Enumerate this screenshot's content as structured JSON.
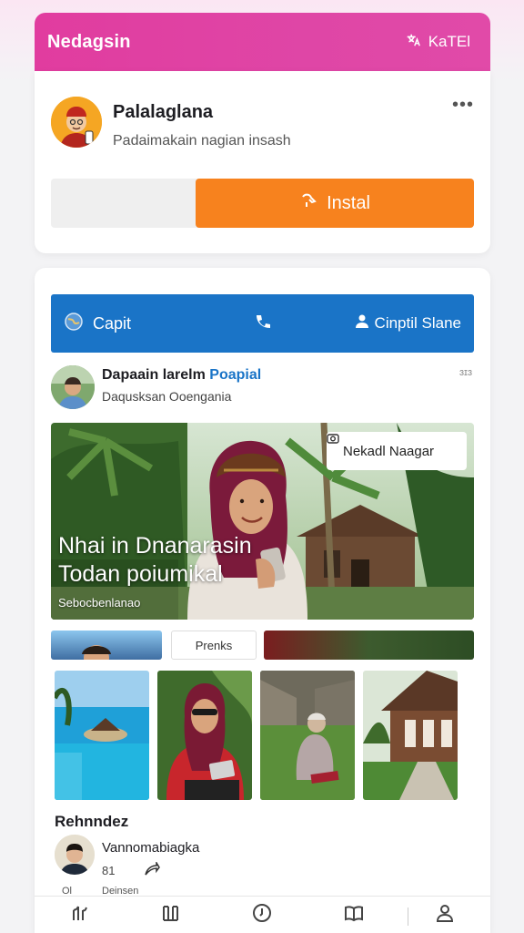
{
  "header": {
    "title": "Nedagsin",
    "action_label": "KaTEl",
    "action_icon": "translate-icon"
  },
  "profile_card": {
    "name": "Palalaglana",
    "subtitle": "Padaimakain nagian insash",
    "more_label": "•••",
    "install_label": "Instal",
    "install_icon": "download-icon",
    "install_color": "#f7821e"
  },
  "call_bar": {
    "left_label": "Capit",
    "right_label": "Cinptil Slane",
    "bar_color": "#1a74c7"
  },
  "post": {
    "author_part1": "Dapaain larelm",
    "author_part2": "Poapial",
    "meta": "Daqusksan Ooengania",
    "more_label": "ɜɪɜ",
    "tag_label": "Nekadl Naagar",
    "headline_line1": "Nhai in Dnanarasin",
    "headline_line2": "Todan poiumikal",
    "caption": "Sebocbenlanao"
  },
  "strip": {
    "middle_label": "Prenks"
  },
  "section": {
    "title": "Rehnndez"
  },
  "user": {
    "name": "Vannomabiagka",
    "count": "81",
    "share_icon": "share-icon"
  },
  "tiny": {
    "left": "Ol",
    "right": "Deinsen"
  },
  "nav": {
    "items": [
      "home-icon",
      "library-icon",
      "clock-icon",
      "book-icon",
      "profile-icon"
    ]
  },
  "colors": {
    "header": "#e13c9f",
    "accent_orange": "#f7821e",
    "accent_blue": "#1a74c7"
  }
}
